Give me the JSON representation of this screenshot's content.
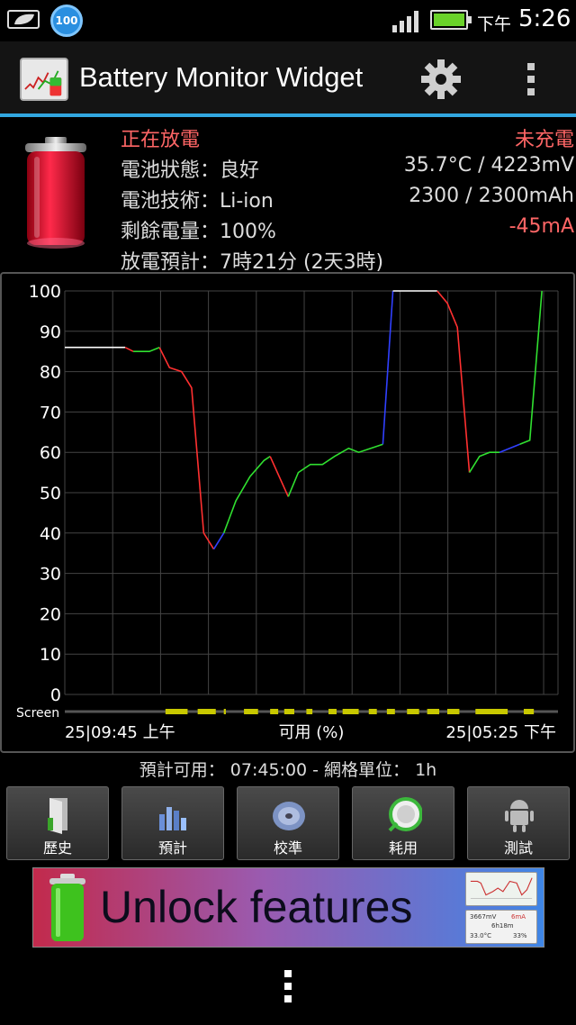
{
  "status_bar": {
    "notification_icon": "battery-leaf-icon",
    "battery_badge": "100",
    "ampm": "下午",
    "time": "5:26"
  },
  "app_bar": {
    "title": "Battery Monitor Widget",
    "settings_icon": "gear-icon",
    "menu_icon": "overflow-menu-icon"
  },
  "info": {
    "state": "正在放電",
    "charge_state": "未充電",
    "health": "電池狀態：良好",
    "temp_voltage": "35.7°C / 4223mV",
    "technology": "電池技術：Li-ion",
    "capacity": "2300 / 2300mAh",
    "level": "剩餘電量：100%",
    "current": "-45mA",
    "estimate": "放電預計：7時21分 (2天3時)"
  },
  "chart_data": {
    "type": "line",
    "y_ticks": [
      "100",
      "90",
      "80",
      "70",
      "60",
      "50",
      "40",
      "30",
      "20",
      "10",
      "0"
    ],
    "ylim": [
      0,
      100
    ],
    "xlim": [
      0,
      22
    ],
    "grid": true,
    "screen_label": "Screen",
    "x_start_label": "25|09:45 上午",
    "x_mid_label": "可用 (%)",
    "x_end_label": "25|05:25 下午",
    "colors": {
      "idle": "#ffffff",
      "discharge": "#ff3030",
      "charge": "#30e030",
      "plugged": "#3040ff",
      "screen_on": "#c8c800"
    },
    "segments": [
      {
        "color": "#ffffff",
        "points": [
          [
            0,
            86
          ],
          [
            3,
            86
          ]
        ]
      },
      {
        "color": "#ff3030",
        "points": [
          [
            3,
            86
          ],
          [
            3.4,
            85
          ]
        ]
      },
      {
        "color": "#30e030",
        "points": [
          [
            3.4,
            85
          ],
          [
            4.2,
            85
          ],
          [
            4.7,
            86
          ]
        ]
      },
      {
        "color": "#ff3030",
        "points": [
          [
            4.7,
            86
          ],
          [
            5.2,
            81
          ],
          [
            5.8,
            80
          ],
          [
            6.3,
            76
          ],
          [
            6.9,
            40
          ],
          [
            7.4,
            36
          ]
        ]
      },
      {
        "color": "#3040ff",
        "points": [
          [
            7.4,
            36
          ],
          [
            7.9,
            40
          ]
        ]
      },
      {
        "color": "#30e030",
        "points": [
          [
            7.9,
            40
          ],
          [
            8.5,
            48
          ],
          [
            9.2,
            54
          ],
          [
            9.9,
            58
          ],
          [
            10.2,
            59
          ]
        ]
      },
      {
        "color": "#ff3030",
        "points": [
          [
            10.2,
            59
          ],
          [
            11.1,
            49
          ]
        ]
      },
      {
        "color": "#30e030",
        "points": [
          [
            11.1,
            49
          ],
          [
            11.6,
            55
          ],
          [
            12.2,
            57
          ],
          [
            12.8,
            57
          ],
          [
            13.4,
            59
          ],
          [
            14.1,
            61
          ],
          [
            14.6,
            60
          ],
          [
            15.2,
            61
          ],
          [
            15.8,
            62
          ]
        ]
      },
      {
        "color": "#3040ff",
        "points": [
          [
            15.8,
            62
          ],
          [
            16.3,
            100
          ]
        ]
      },
      {
        "color": "#ffffff",
        "points": [
          [
            16.3,
            100
          ],
          [
            18.5,
            100
          ]
        ]
      },
      {
        "color": "#ff3030",
        "points": [
          [
            18.5,
            100
          ],
          [
            19,
            97
          ],
          [
            19.5,
            91
          ],
          [
            20.1,
            55
          ]
        ]
      },
      {
        "color": "#30e030",
        "points": [
          [
            20.1,
            55
          ],
          [
            20.6,
            59
          ],
          [
            21.1,
            60
          ],
          [
            21.6,
            60
          ]
        ]
      },
      {
        "color": "#3040ff",
        "points": [
          [
            21.6,
            60
          ],
          [
            22.6,
            62
          ]
        ]
      },
      {
        "color": "#30e030",
        "points": [
          [
            22.6,
            62
          ],
          [
            23.1,
            63
          ],
          [
            23.7,
            100
          ]
        ]
      }
    ],
    "screen_on": [
      [
        5.0,
        6.1
      ],
      [
        6.6,
        7.5
      ],
      [
        7.9,
        8.0
      ],
      [
        8.9,
        9.6
      ],
      [
        10.2,
        10.6
      ],
      [
        10.9,
        11.4
      ],
      [
        12.0,
        12.3
      ],
      [
        13.1,
        13.5
      ],
      [
        13.8,
        14.6
      ],
      [
        15.1,
        15.5
      ],
      [
        16.0,
        16.4
      ],
      [
        17.0,
        17.6
      ],
      [
        18.0,
        18.6
      ],
      [
        19.0,
        19.6
      ],
      [
        20.4,
        22.0
      ],
      [
        22.8,
        23.3
      ]
    ]
  },
  "estimate_line": "預計可用： 07:45:00 - 網格單位： 1h",
  "tools": [
    {
      "label": "歷史",
      "icon": "history-door-icon"
    },
    {
      "label": "預計",
      "icon": "forecast-chart-icon"
    },
    {
      "label": "校準",
      "icon": "calibrate-disc-icon"
    },
    {
      "label": "耗用",
      "icon": "usage-globe-icon"
    },
    {
      "label": "測試",
      "icon": "android-robot-icon"
    }
  ],
  "banner": {
    "text": "Unlock features",
    "thumb2_line1": "3667mV",
    "thumb2_line2": "6mA",
    "thumb2_line3": "6h18m",
    "thumb2_line4": "33.0°C",
    "thumb2_line5": "33%"
  }
}
